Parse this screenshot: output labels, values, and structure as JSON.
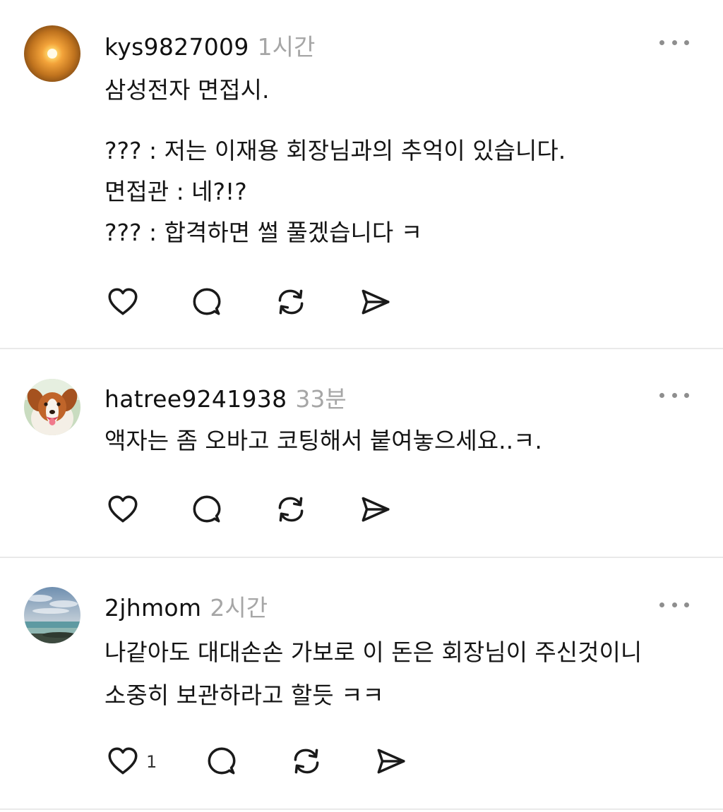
{
  "colors": {
    "text": "#151515",
    "muted_time": "#a6a6a6",
    "icon_stroke": "#1a1a1a",
    "divider": "#e9e9e9",
    "more_dots": "#8e8e8e"
  },
  "icons": {
    "like": "heart-outline",
    "reply": "speech-bubble-outline",
    "repost": "circular-arrows",
    "share": "paper-plane"
  },
  "comments": [
    {
      "username": "kys9827009",
      "time": "1시간",
      "avatar": "sunset-avatar",
      "lines": [
        "삼성전자 면접시.",
        "??? : 저는 이재용 회장님과의 추억이 있습니다.",
        "면접관 : 네?!?",
        "??? : 합격하면 썰 풀겠습니다 ㅋ"
      ]
    },
    {
      "username": "hatree9241938",
      "time": "33분",
      "avatar": "dog-avatar",
      "lines": [
        "액자는 좀 오바고 코팅해서 붙여놓으세요..ㅋ."
      ]
    },
    {
      "username": "2jhmom",
      "time": "2시간",
      "avatar": "sea-avatar",
      "lines": [
        "나같아도 대대손손 가보로 이 돈은 회장님이 주신것이니",
        "소중히 보관하라고 할듯 ㅋㅋ"
      ],
      "like_count": "1"
    }
  ]
}
